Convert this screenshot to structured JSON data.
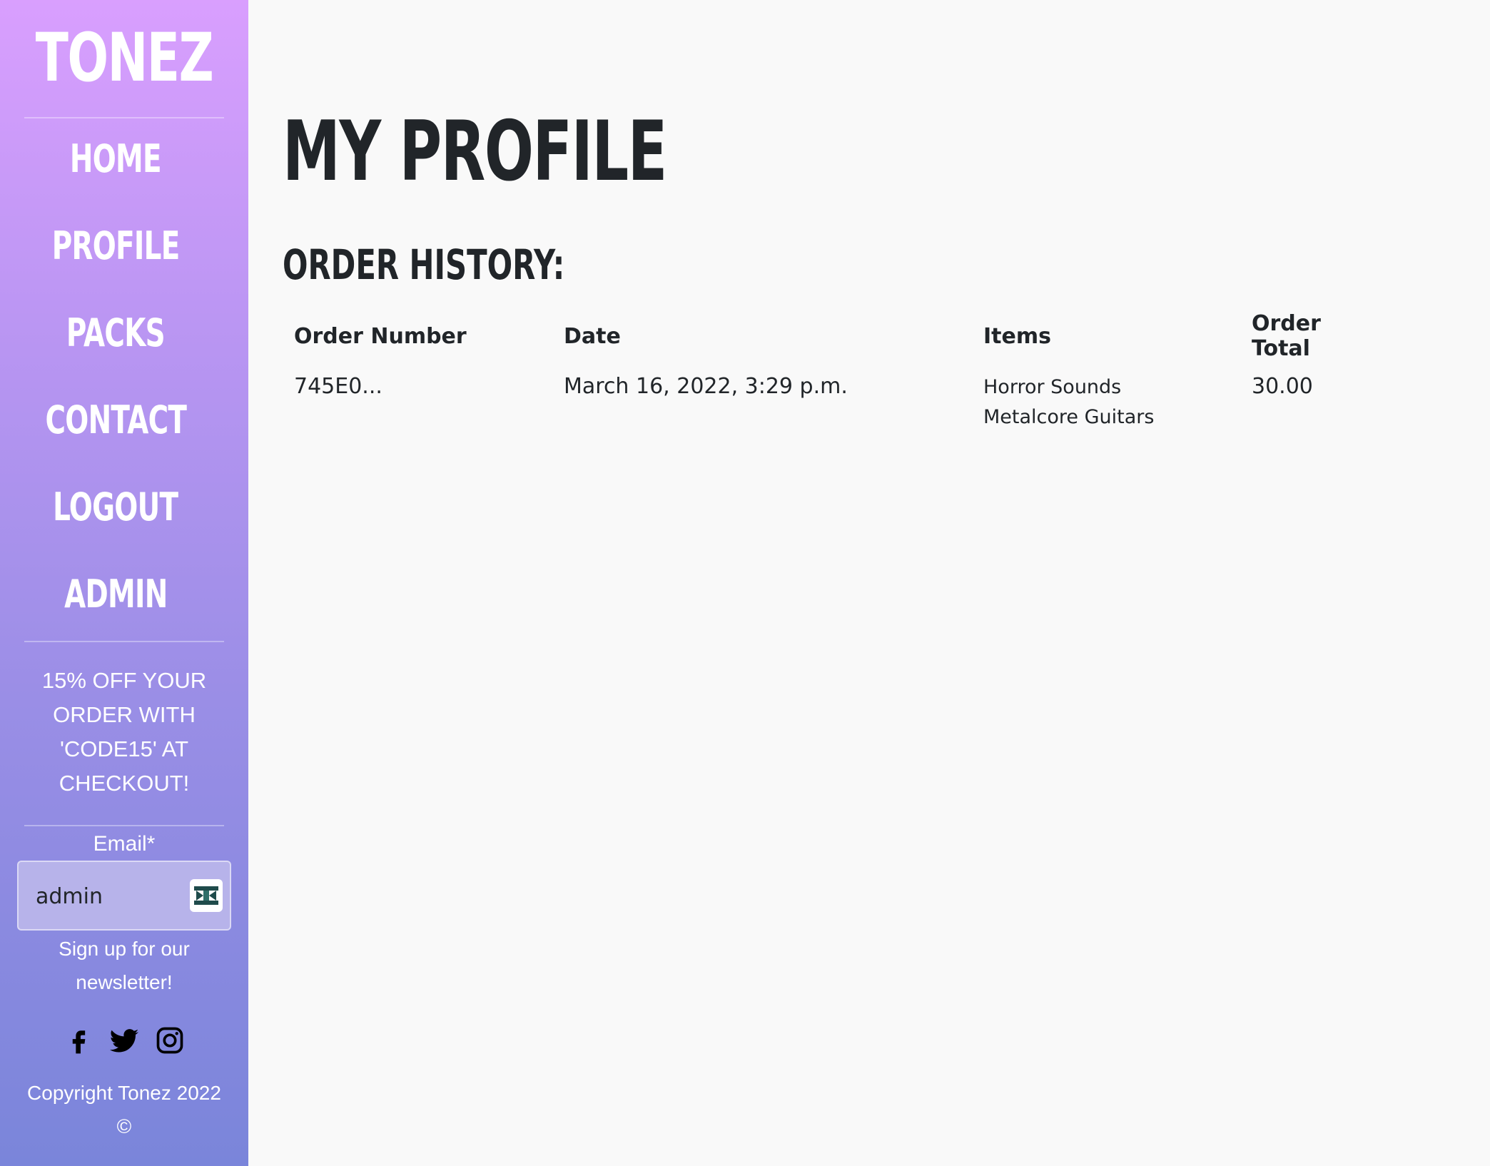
{
  "sidebar": {
    "logo": "TONEZ",
    "nav": [
      {
        "label": "HOME"
      },
      {
        "label": "PROFILE"
      },
      {
        "label": "PACKS"
      },
      {
        "label": "CONTACT"
      },
      {
        "label": "LOGOUT"
      },
      {
        "label": "ADMIN"
      }
    ],
    "promo": "15% OFF YOUR ORDER WITH 'CODE15' AT CHECKOUT!",
    "newsletter": {
      "email_label": "Email*",
      "email_value": "admin",
      "signup_text": "Sign up for our newsletter!"
    },
    "socials": [
      "facebook-icon",
      "twitter-icon",
      "instagram-icon"
    ],
    "copyright": "Copyright Tonez 2022 ©"
  },
  "main": {
    "title": "MY PROFILE",
    "order_history": {
      "heading": "ORDER HISTORY:",
      "columns": [
        "Order Number",
        "Date",
        "Items",
        "Order Total"
      ],
      "rows": [
        {
          "order_number": "745E0...",
          "date": "March 16, 2022, 3:29 p.m.",
          "items": [
            "Horror Sounds",
            "Metalcore Guitars"
          ],
          "total": "30.00"
        }
      ]
    }
  },
  "colors": {
    "sidebar_gradient_top": "#d99ffe",
    "sidebar_gradient_bottom": "#7a85da",
    "main_background": "#f9f9f9",
    "text_dark": "#212529"
  }
}
